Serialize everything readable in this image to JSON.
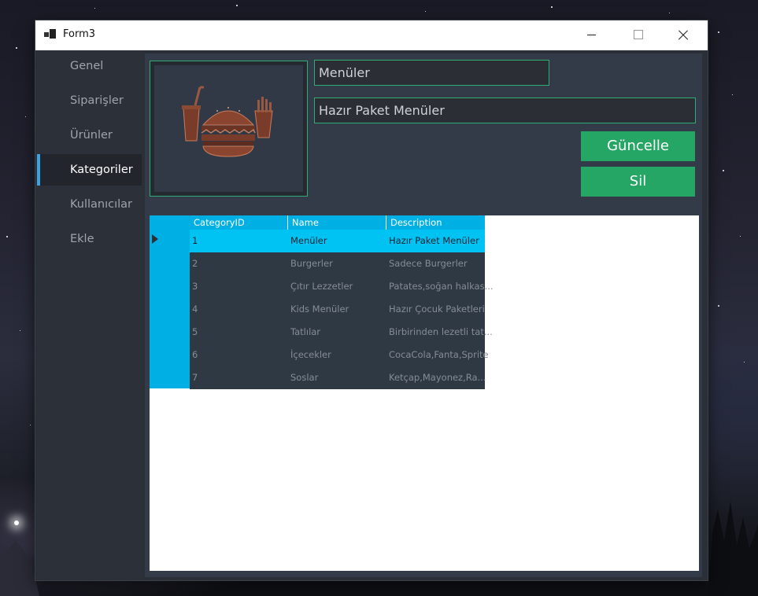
{
  "window": {
    "title": "Form3",
    "minimize_icon": "minimize-icon",
    "maximize_icon": "maximize-icon",
    "close_icon": "close-icon"
  },
  "sidebar": {
    "items": [
      {
        "label": "Genel",
        "active": false
      },
      {
        "label": "Siparişler",
        "active": false
      },
      {
        "label": "Ürünler",
        "active": false
      },
      {
        "label": "Kategoriler",
        "active": true
      },
      {
        "label": "Kullanıcılar",
        "active": false
      },
      {
        "label": "Ekle",
        "active": false
      }
    ],
    "accent_color": "#3aa3e3"
  },
  "form": {
    "category_image_icon": "food-menu-icon",
    "name_value": "Menüler",
    "description_value": "Hazır Paket Menüler",
    "update_label": "Güncelle",
    "delete_label": "Sil",
    "button_color": "#25a665",
    "field_border_color": "#2ead74"
  },
  "grid": {
    "columns": [
      "CategoryID",
      "Name",
      "Description"
    ],
    "header_color": "#00b0e4",
    "selected_row_color": "#00c2f3",
    "rows": [
      {
        "id": "1",
        "name": "Menüler",
        "description": "Hazır Paket Menüler",
        "selected": true
      },
      {
        "id": "2",
        "name": "Burgerler",
        "description": "Sadece Burgerler",
        "selected": false
      },
      {
        "id": "3",
        "name": "Çıtır Lezzetler",
        "description": "Patates,soğan halkas...",
        "selected": false
      },
      {
        "id": "4",
        "name": "Kids Menüler",
        "description": "Hazır Çocuk Paketleri",
        "selected": false
      },
      {
        "id": "5",
        "name": "Tatlılar",
        "description": "Birbirinden lezetli tat...",
        "selected": false
      },
      {
        "id": "6",
        "name": "İçecekler",
        "description": "CocaCola,Fanta,Sprite",
        "selected": false
      },
      {
        "id": "7",
        "name": "Soslar",
        "description": "Ketçap,Mayonez,Ra...",
        "selected": false
      }
    ]
  }
}
